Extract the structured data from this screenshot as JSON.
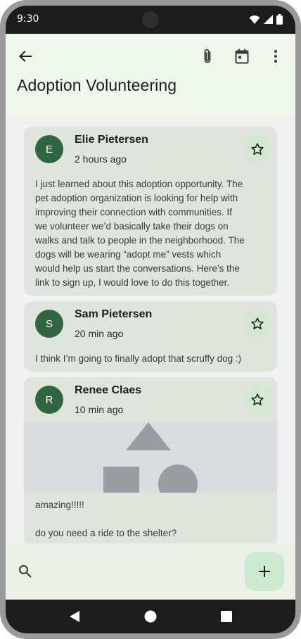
{
  "status_bar": {
    "time": "9:30"
  },
  "header": {
    "title": "Adoption Volunteering"
  },
  "messages": [
    {
      "initial": "E",
      "sender": "Elie Pietersen",
      "time": "2 hours ago",
      "body_lines": [
        "I just learned about this adoption opportunity. The",
        "pet adoption organization is looking for help with",
        "improving their connection with communities. If",
        "we volunteer we’d basically take their dogs on",
        "walks and talk to people in the neighborhood. The",
        "dogs will be wearing “adopt me” vests which",
        "would help us start the conversations. Here’s the",
        "link to sign up, I would love to do this together."
      ]
    },
    {
      "initial": "S",
      "sender": "Sam Pietersen",
      "time": "20 min ago",
      "body_lines": [
        "I think I’m going to finally adopt that scruffy dog :)"
      ]
    },
    {
      "initial": "R",
      "sender": "Renee Claes",
      "time": "10 min ago",
      "body_lines": [
        "amazing!!!!!",
        "",
        "do you need a ride to the shelter?"
      ]
    }
  ],
  "icons": {
    "back": "arrow-back-icon",
    "attach": "paperclip-icon",
    "calendar": "calendar-icon",
    "more": "more-vert-icon",
    "star": "star-outline-icon",
    "search": "search-icon",
    "add": "plus-icon"
  },
  "colors": {
    "avatar": "#2f6641",
    "card": "#dfe4dc",
    "header_bg": "#f0f7ec",
    "fab_bg": "#cde9d2"
  }
}
